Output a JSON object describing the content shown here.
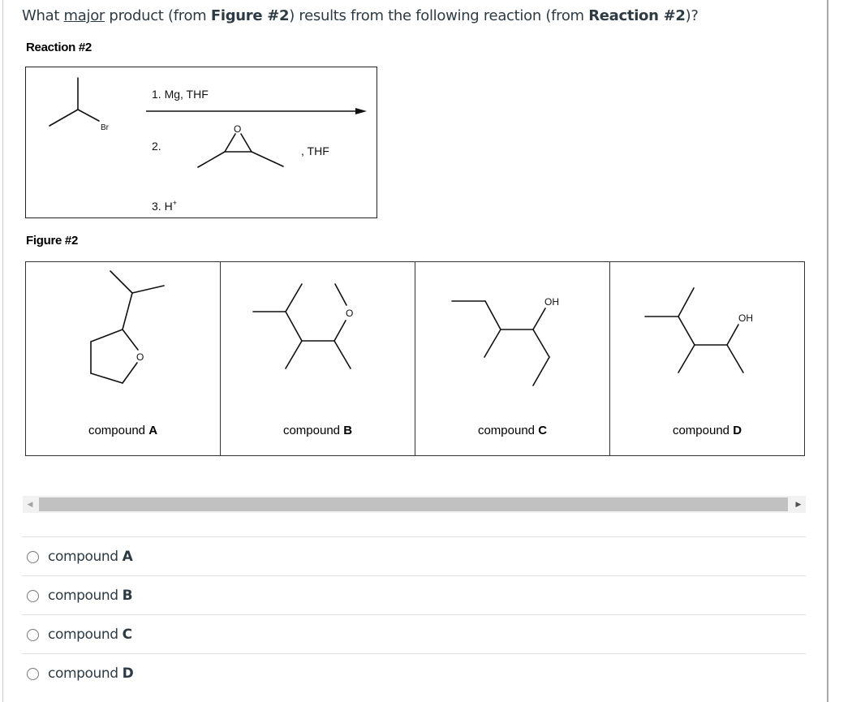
{
  "question": {
    "prefix": "What ",
    "underlined": "major",
    "middle1": " product (from ",
    "bold1": "Figure #2",
    "middle2": ") results from the following reaction (from ",
    "bold2": "Reaction #2",
    "suffix": ")?"
  },
  "reaction": {
    "label": "Reaction #2",
    "reactant_atom_label": "Br",
    "step1": "1.  Mg, THF",
    "step2_number": "2.",
    "step2_reagent_atom": "O",
    "step2_solvent": ", THF",
    "step3_prefix": "3.  H",
    "step3_superscript": "+"
  },
  "figure": {
    "label": "Figure #2",
    "compounds": [
      {
        "prefix": "compound ",
        "letter": "A",
        "atoms": [
          "O"
        ]
      },
      {
        "prefix": "compound ",
        "letter": "B",
        "atoms": [
          "O"
        ]
      },
      {
        "prefix": "compound ",
        "letter": "C",
        "atoms": [
          "OH"
        ]
      },
      {
        "prefix": "compound ",
        "letter": "D",
        "atoms": [
          "OH"
        ]
      }
    ]
  },
  "scrollbar": {
    "left_arrow": "◀",
    "right_arrow": "▶"
  },
  "answer_options": [
    {
      "prefix": "compound ",
      "letter": "A",
      "selected": false
    },
    {
      "prefix": "compound ",
      "letter": "B",
      "selected": false
    },
    {
      "prefix": "compound ",
      "letter": "C",
      "selected": false
    },
    {
      "prefix": "compound ",
      "letter": "D",
      "selected": false
    }
  ]
}
